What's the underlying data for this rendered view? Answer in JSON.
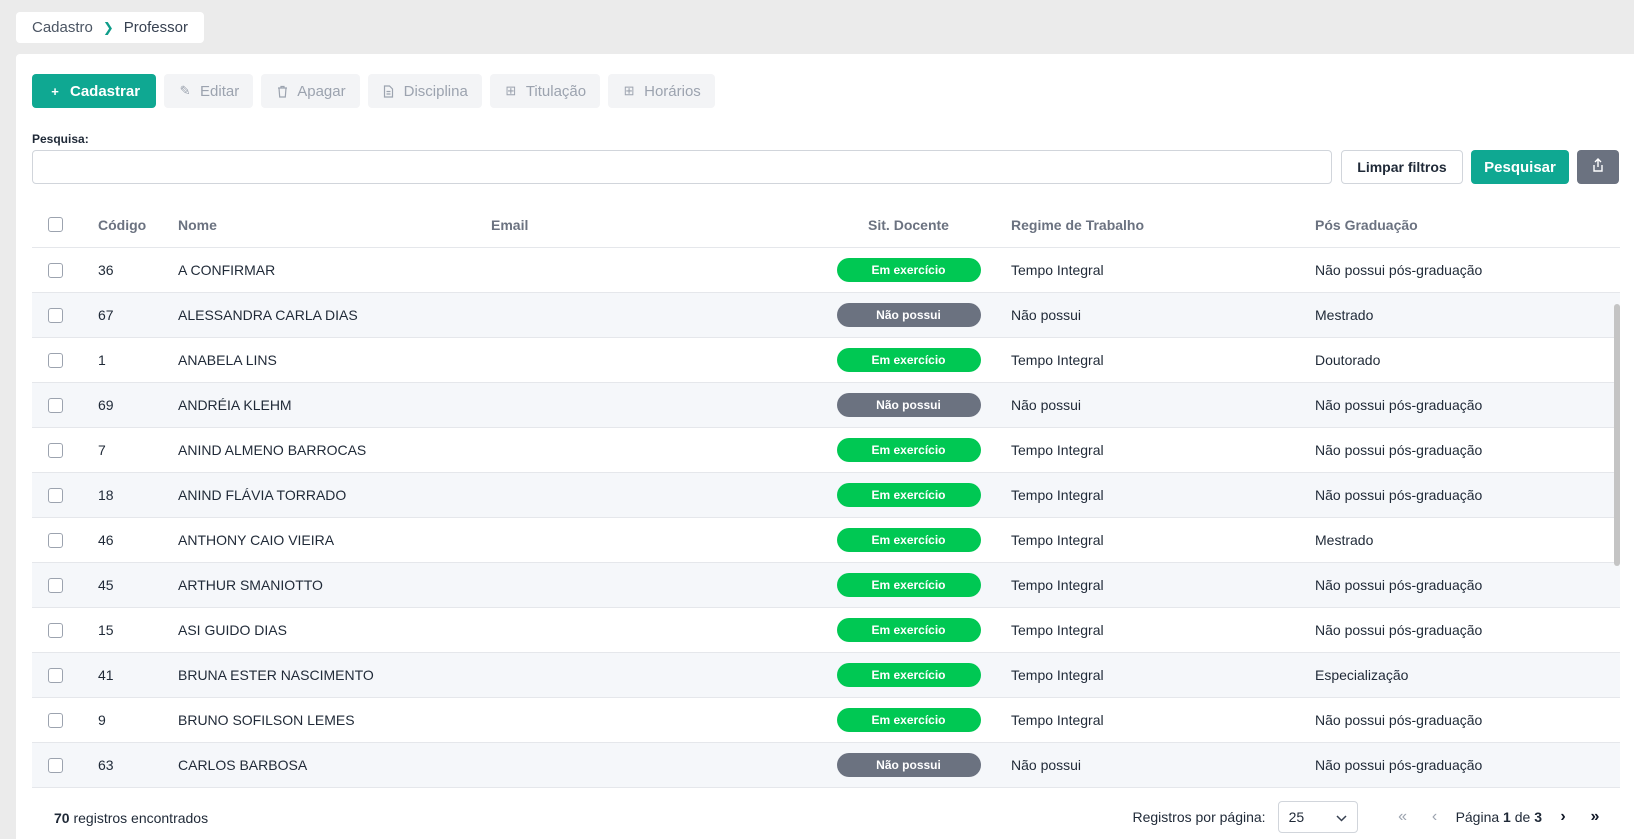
{
  "breadcrumb": {
    "parent": "Cadastro",
    "current": "Professor"
  },
  "toolbar": {
    "cadastrar": "Cadastrar",
    "editar": "Editar",
    "apagar": "Apagar",
    "disciplina": "Disciplina",
    "titulacao": "Titulação",
    "horarios": "Horários"
  },
  "search": {
    "label": "Pesquisa:",
    "value": "",
    "placeholder": "",
    "clear_label": "Limpar filtros",
    "search_label": "Pesquisar"
  },
  "table": {
    "headers": {
      "codigo": "Código",
      "nome": "Nome",
      "email": "Email",
      "situacao": "Sit. Docente",
      "regime": "Regime de Trabalho",
      "pos": "Pós Graduação"
    },
    "rows": [
      {
        "codigo": "36",
        "nome": "A CONFIRMAR",
        "email": "",
        "situacao": "Em exercício",
        "regime": "Tempo Integral",
        "pos": "Não possui pós-graduação"
      },
      {
        "codigo": "67",
        "nome": "ALESSANDRA CARLA DIAS",
        "email": "",
        "situacao": "Não possui",
        "regime": "Não possui",
        "pos": "Mestrado"
      },
      {
        "codigo": "1",
        "nome": "ANABELA LINS",
        "email": "",
        "situacao": "Em exercício",
        "regime": "Tempo Integral",
        "pos": "Doutorado"
      },
      {
        "codigo": "69",
        "nome": "ANDRÉIA KLEHM",
        "email": "",
        "situacao": "Não possui",
        "regime": "Não possui",
        "pos": "Não possui pós-graduação"
      },
      {
        "codigo": "7",
        "nome": "ANIND ALMENO BARROCAS",
        "email": "",
        "situacao": "Em exercício",
        "regime": "Tempo Integral",
        "pos": "Não possui pós-graduação"
      },
      {
        "codigo": "18",
        "nome": "ANIND FLÁVIA TORRADO",
        "email": "",
        "situacao": "Em exercício",
        "regime": "Tempo Integral",
        "pos": "Não possui pós-graduação"
      },
      {
        "codigo": "46",
        "nome": "ANTHONY CAIO VIEIRA",
        "email": "",
        "situacao": "Em exercício",
        "regime": "Tempo Integral",
        "pos": "Mestrado"
      },
      {
        "codigo": "45",
        "nome": "ARTHUR SMANIOTTO",
        "email": "",
        "situacao": "Em exercício",
        "regime": "Tempo Integral",
        "pos": "Não possui pós-graduação"
      },
      {
        "codigo": "15",
        "nome": "ASI GUIDO DIAS",
        "email": "",
        "situacao": "Em exercício",
        "regime": "Tempo Integral",
        "pos": "Não possui pós-graduação"
      },
      {
        "codigo": "41",
        "nome": "BRUNA ESTER NASCIMENTO",
        "email": "",
        "situacao": "Em exercício",
        "regime": "Tempo Integral",
        "pos": "Especialização"
      },
      {
        "codigo": "9",
        "nome": "BRUNO SOFILSON LEMES",
        "email": "",
        "situacao": "Em exercício",
        "regime": "Tempo Integral",
        "pos": "Não possui pós-graduação"
      },
      {
        "codigo": "63",
        "nome": "CARLOS BARBOSA",
        "email": "",
        "situacao": "Não possui",
        "regime": "Não possui",
        "pos": "Não possui pós-graduação"
      }
    ]
  },
  "status_colors": {
    "Em exercício": "#00c853",
    "Não possui": "#6b7280"
  },
  "footer": {
    "count": "70",
    "count_suffix": " registros encontrados",
    "per_page_label": "Registros por página:",
    "per_page_value": "25",
    "page_prefix": "Página ",
    "page_current": "1",
    "page_of": " de ",
    "page_total": "3"
  }
}
